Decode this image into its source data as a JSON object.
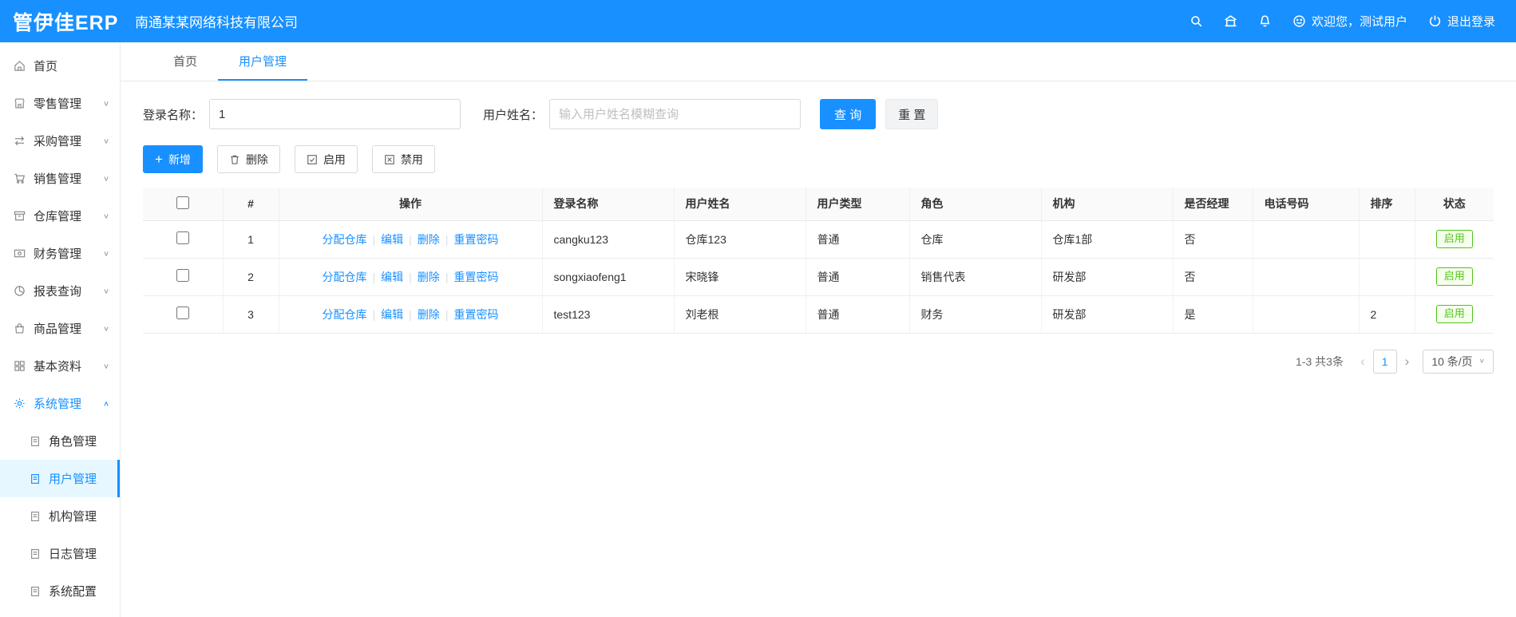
{
  "colors": {
    "primary": "#1890ff",
    "success": "#52c41a"
  },
  "glyphs": {
    "chevron_down": "∨",
    "chevron_up": "∧",
    "caret": "∨",
    "separator": "|",
    "plus": "+",
    "prev": "‹",
    "next": "›"
  },
  "topbar": {
    "logo": "管伊佳ERP",
    "company": "南通某某网络科技有限公司",
    "welcome": "欢迎您，测试用户",
    "logout": "退出登录"
  },
  "sidebar": {
    "items": [
      {
        "label": "首页"
      },
      {
        "label": "零售管理"
      },
      {
        "label": "采购管理"
      },
      {
        "label": "销售管理"
      },
      {
        "label": "仓库管理"
      },
      {
        "label": "财务管理"
      },
      {
        "label": "报表查询"
      },
      {
        "label": "商品管理"
      },
      {
        "label": "基本资料"
      },
      {
        "label": "系统管理"
      }
    ],
    "subitems": [
      {
        "label": "角色管理"
      },
      {
        "label": "用户管理"
      },
      {
        "label": "机构管理"
      },
      {
        "label": "日志管理"
      },
      {
        "label": "系统配置"
      }
    ]
  },
  "tabs": {
    "items": [
      {
        "label": "首页"
      },
      {
        "label": "用户管理"
      }
    ]
  },
  "filters": {
    "login_label": "登录名称：",
    "login_value": "1",
    "name_label": "用户姓名：",
    "name_placeholder": "输入用户姓名模糊查询",
    "query_label": "查 询",
    "reset_label": "重 置"
  },
  "toolbar": {
    "add_label": "新增",
    "delete_label": "删除",
    "enable_label": "启用",
    "disable_label": "禁用"
  },
  "table": {
    "headers": [
      "#",
      "操作",
      "登录名称",
      "用户姓名",
      "用户类型",
      "角色",
      "机构",
      "是否经理",
      "电话号码",
      "排序",
      "状态"
    ],
    "action_links": [
      "分配仓库",
      "编辑",
      "删除",
      "重置密码"
    ],
    "rows": [
      {
        "num": "1",
        "login": "cangku123",
        "name": "仓库123",
        "type": "普通",
        "role": "仓库",
        "org": "仓库1部",
        "manager": "否",
        "phone": "",
        "sort": "",
        "status": "启用"
      },
      {
        "num": "2",
        "login": "songxiaofeng1",
        "name": "宋晓锋",
        "type": "普通",
        "role": "销售代表",
        "org": "研发部",
        "manager": "否",
        "phone": "",
        "sort": "",
        "status": "启用"
      },
      {
        "num": "3",
        "login": "test123",
        "name": "刘老根",
        "type": "普通",
        "role": "财务",
        "org": "研发部",
        "manager": "是",
        "phone": "",
        "sort": "2",
        "status": "启用"
      }
    ]
  },
  "pagination": {
    "total": "1-3 共3条",
    "page": "1",
    "size": "10 条/页"
  }
}
